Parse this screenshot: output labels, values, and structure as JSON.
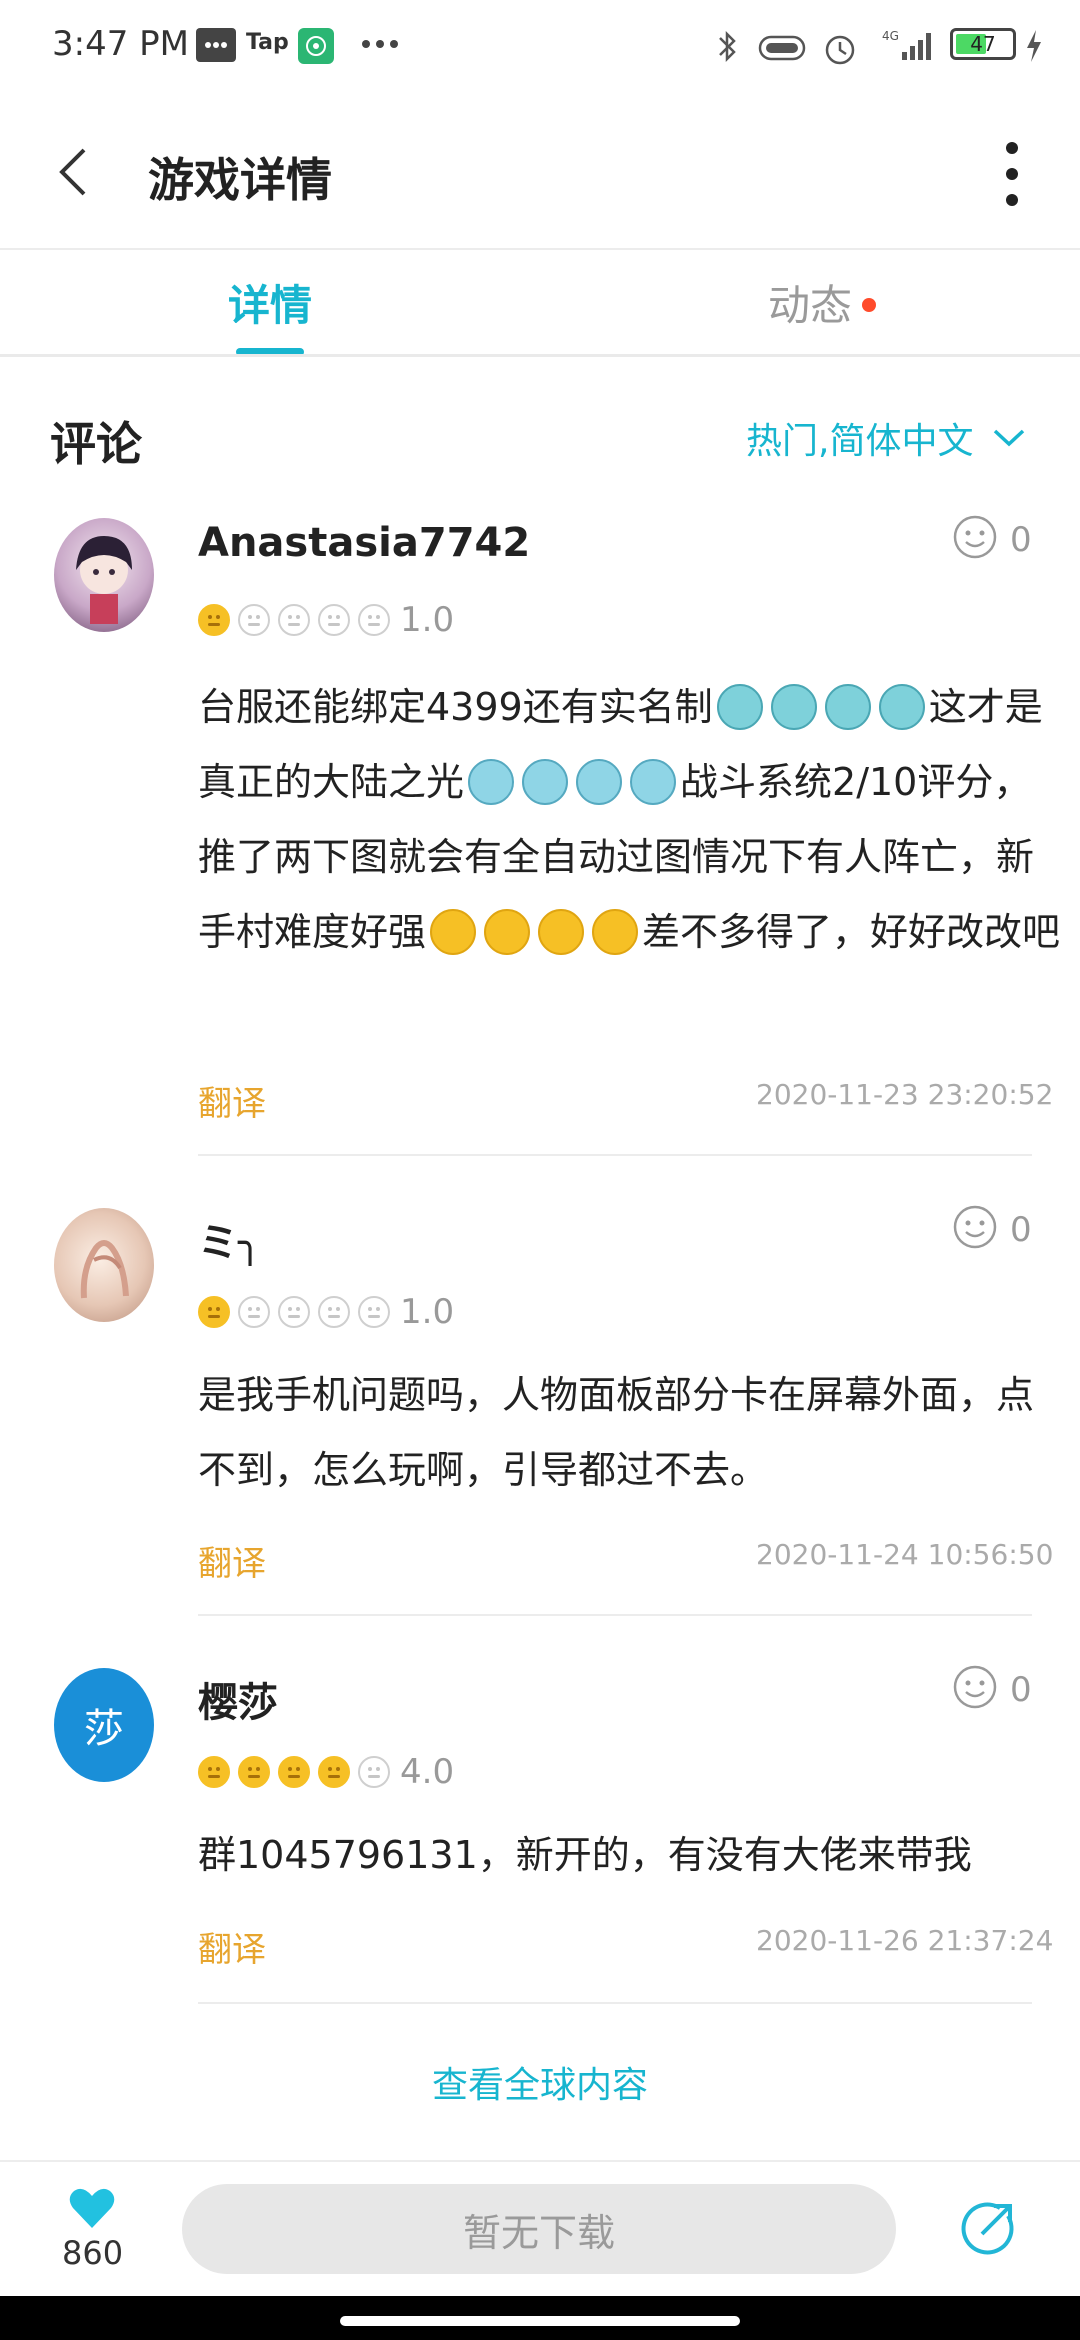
{
  "status_bar": {
    "time": "3:47 PM",
    "battery": "47",
    "network": "4G",
    "tap_label": "Tap"
  },
  "app_bar": {
    "title": "游戏详情"
  },
  "tabs": [
    {
      "label": "详情",
      "active": true
    },
    {
      "label": "动态",
      "active": false,
      "has_dot": true
    }
  ],
  "comments_section": {
    "title": "评论",
    "filter_label": "热门,简体中文"
  },
  "reviews": [
    {
      "username": "Anastasia7742",
      "rating": "1.0",
      "rating_stars": 1,
      "likes": "0",
      "text_segments": [
        "台服还能绑定4399还有实名制",
        "这才是真正的大陆之光",
        "战斗系统2/10评分，推了两下图就会有全自动过图情况下有人阵亡，新手村难度好强",
        "差不多得了，好好改改吧"
      ],
      "translate_label": "翻译",
      "timestamp": "2020-11-23 23:20:52"
    },
    {
      "username": "ミ╮",
      "rating": "1.0",
      "rating_stars": 1,
      "likes": "0",
      "text": "是我手机问题吗，人物面板部分卡在屏幕外面，点不到，怎么玩啊，引导都过不去。",
      "translate_label": "翻译",
      "timestamp": "2020-11-24 10:56:50"
    },
    {
      "username": "樱莎",
      "avatar_text": "莎",
      "rating": "4.0",
      "rating_stars": 4,
      "likes": "0",
      "text": "群1045796131，新开的，有没有大佬来带我",
      "translate_label": "翻译",
      "timestamp": "2020-11-26 21:37:24"
    }
  ],
  "view_global_label": "查看全球内容",
  "bottom_bar": {
    "favorite_count": "860",
    "download_label": "暂无下载"
  },
  "colors": {
    "accent": "#17b5cf",
    "translate": "#e7a52e",
    "dot": "#ff4b2b",
    "rating_on": "#f6c025",
    "avatar_blue": "#1a8fd8"
  },
  "icons": [
    "back-arrow-icon",
    "more-vertical-icon",
    "chevron-down-icon",
    "smile-like-icon",
    "heart-icon",
    "share-icon",
    "bluetooth-icon",
    "alarm-icon",
    "signal-icon",
    "battery-icon",
    "message-icon",
    "podcast-icon",
    "dots-icon"
  ]
}
